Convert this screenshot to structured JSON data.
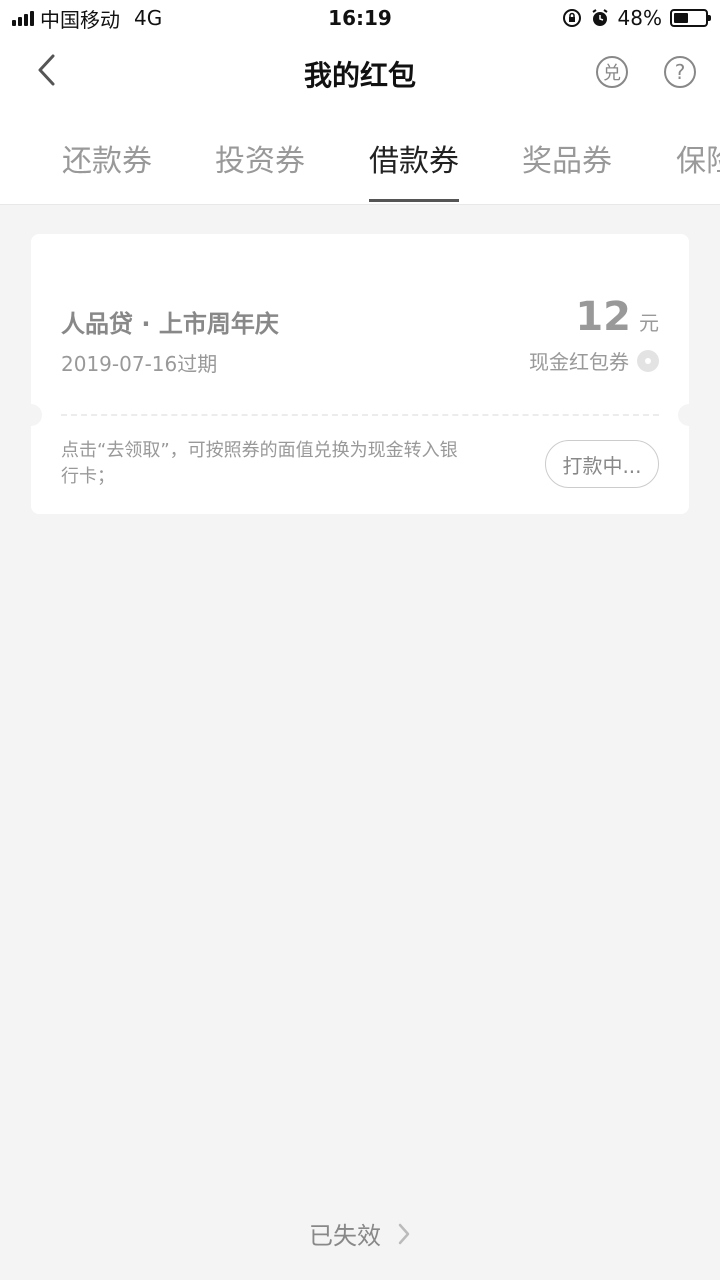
{
  "status_bar": {
    "carrier": "中国移动",
    "network": "4G",
    "time": "16:19",
    "battery": "48%",
    "battery_level": 0.48
  },
  "nav": {
    "title": "我的红包",
    "exchange_icon_text": "兑",
    "help_icon_text": "?"
  },
  "tabs": [
    {
      "label": "还款券"
    },
    {
      "label": "投资券"
    },
    {
      "label": "借款券"
    },
    {
      "label": "奖品券"
    },
    {
      "label": "保险"
    }
  ],
  "active_tab": "借款券",
  "coupon": {
    "title": "人品贷 · 上市周年庆",
    "expiry": "2019-07-16过期",
    "amount": "12",
    "unit": "元",
    "type": "现金红包券",
    "description": "点击“去领取”，可按照券的面值兑换为现金转入银行卡；",
    "status_button": "打款中..."
  },
  "footer": {
    "expired_link": "已失效"
  },
  "colors": {
    "background": "#f4f4f4",
    "card": "#ffffff",
    "muted_text": "#999999",
    "active_tab_underline": "#555555"
  }
}
